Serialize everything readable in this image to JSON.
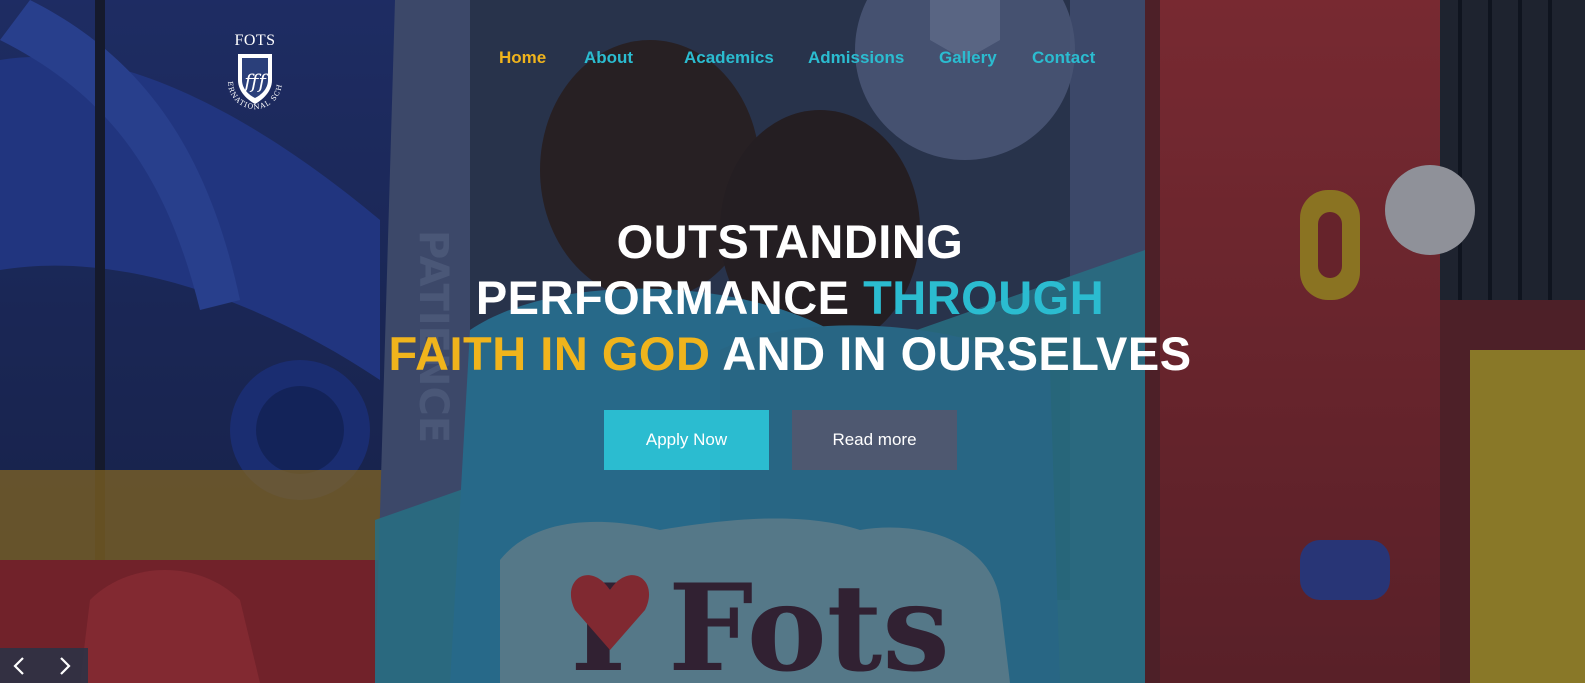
{
  "header": {
    "logo": {
      "wordmark": "FOTS",
      "ring_text": "INTERNATIONAL SCHOOL",
      "crest_icon": "shield-crest-icon"
    },
    "nav": [
      {
        "label": "Home",
        "active": true
      },
      {
        "label": "About",
        "active": false
      },
      {
        "label": "Academics",
        "active": false
      },
      {
        "label": "Admissions",
        "active": false
      },
      {
        "label": "Gallery",
        "active": false
      },
      {
        "label": "Contact",
        "active": false
      }
    ]
  },
  "hero": {
    "headline": {
      "line1": "OUTSTANDING",
      "line2_white": "PERFORMANCE ",
      "line2_teal": "THROUGH",
      "line3_gold": "FAITH IN GOD",
      "line3_white": " AND IN OURSELVES"
    },
    "buttons": {
      "apply_label": "Apply Now",
      "read_label": "Read more"
    },
    "slider": {
      "prev_icon": "chevron-left-icon",
      "next_icon": "chevron-right-icon"
    }
  },
  "colors": {
    "accent_teal": "#2bbcd0",
    "accent_gold": "#f0b41c",
    "secondary_button": "#4e5870",
    "text_white": "#ffffff"
  }
}
